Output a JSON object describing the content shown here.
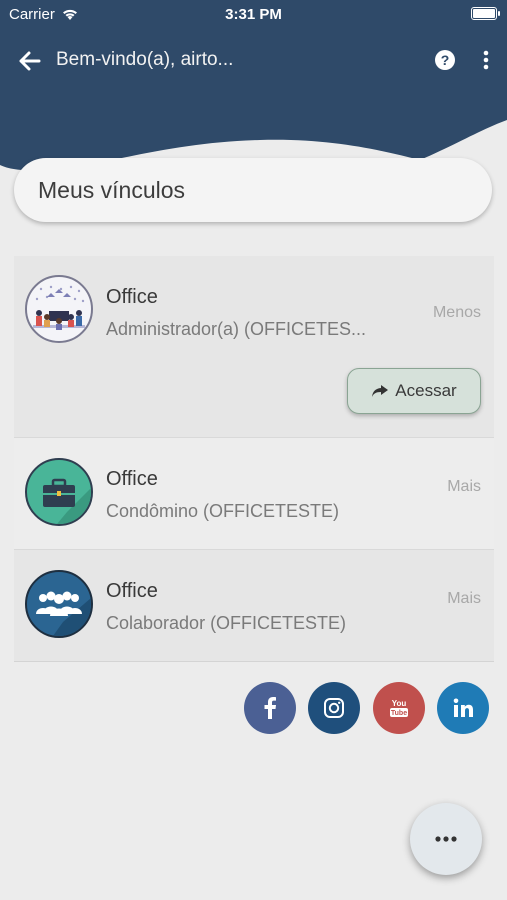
{
  "status_bar": {
    "carrier": "Carrier",
    "time": "3:31 PM"
  },
  "nav": {
    "title": "Bem-vindo(a), airto..."
  },
  "section": {
    "title": "Meus vínculos"
  },
  "links": [
    {
      "name": "Office",
      "role": "Administrador(a) (OFFICETES...",
      "toggle": "Menos",
      "action": "Acessar",
      "icon": "team-illustration"
    },
    {
      "name": "Office",
      "role": "Condômino (OFFICETESTE)",
      "toggle": "Mais",
      "icon": "briefcase-icon"
    },
    {
      "name": "Office",
      "role": "Colaborador (OFFICETESTE)",
      "toggle": "Mais",
      "icon": "people-group-icon"
    }
  ],
  "social": [
    {
      "name": "facebook",
      "color": "#3b5998"
    },
    {
      "name": "instagram",
      "color": "#1f4f7c"
    },
    {
      "name": "youtube",
      "color": "#c0504d",
      "text": "You Tube"
    },
    {
      "name": "linkedin",
      "color": "#1f7bb6"
    }
  ],
  "colors": {
    "header": "#2f4a69",
    "background": "#ececec"
  }
}
